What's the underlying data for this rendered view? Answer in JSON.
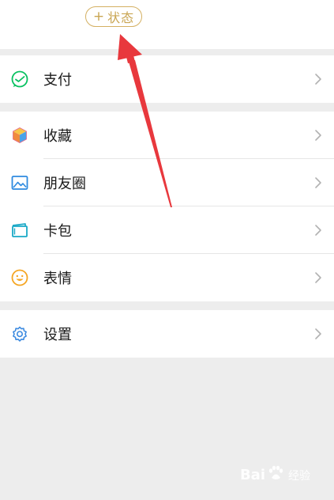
{
  "status_button": {
    "plus": "+",
    "label": "状态"
  },
  "menu": {
    "pay": "支付",
    "favorites": "收藏",
    "moments": "朋友圈",
    "cards": "卡包",
    "stickers": "表情",
    "settings": "设置"
  },
  "watermark": {
    "brand_left": "Bai",
    "brand_right": "经验"
  },
  "colors": {
    "background": "#ededed",
    "status_gold": "#d4b062",
    "pay_green": "#07c160",
    "settings_blue": "#3d8be0",
    "sticker_orange": "#f5a623",
    "arrow_red": "#e8383d"
  }
}
